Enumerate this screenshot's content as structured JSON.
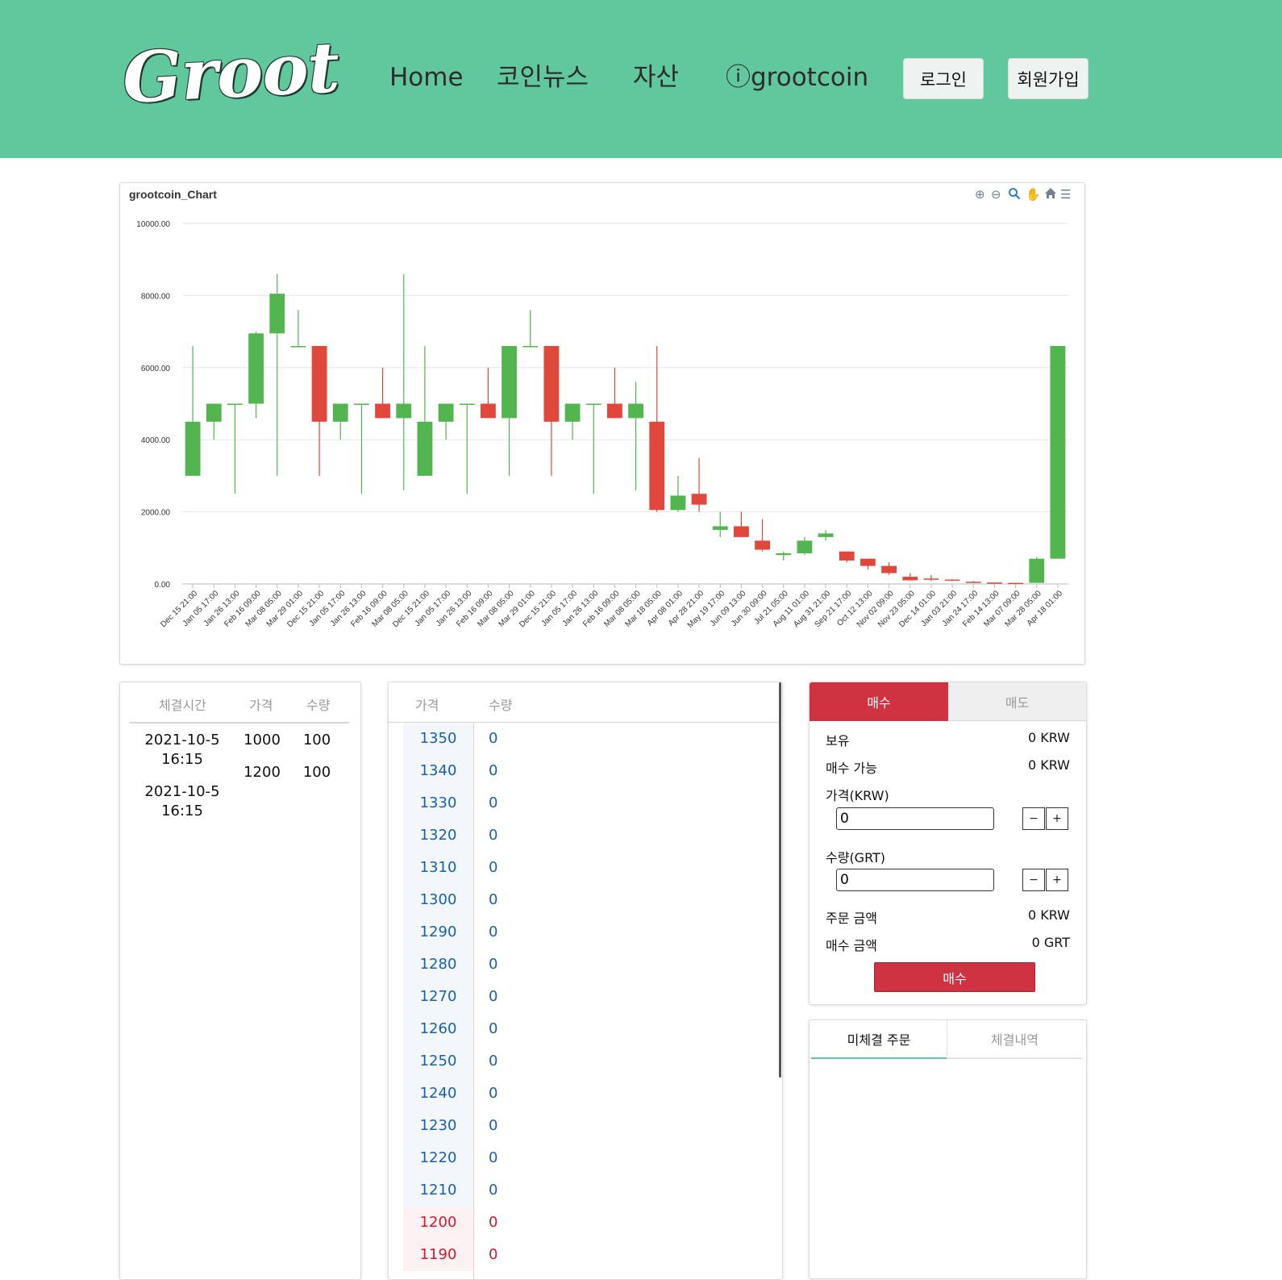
{
  "header": {
    "logo_text": "Groot",
    "nav": [
      "Home",
      "코인뉴스",
      "자산",
      "ⓘgrootcoin"
    ],
    "login_label": "로그인",
    "signup_label": "회원가입"
  },
  "chart": {
    "title": "grootcoin_Chart",
    "toolbar_icons": [
      "zoom-in-icon",
      "zoom-out-icon",
      "zoom-select-icon",
      "pan-hand-icon",
      "home-reset-icon",
      "menu-icon"
    ]
  },
  "chart_data": {
    "type": "candlestick",
    "ylim": [
      0,
      10000
    ],
    "yticks": [
      "0.00",
      "2000.00",
      "4000.00",
      "6000.00",
      "8000.00",
      "10000.00"
    ],
    "grid": true,
    "xtick_labels": [
      "Dec 15 21:00",
      "Jan 05 17:00",
      "Jan 26 13:00",
      "Feb 16 09:00",
      "Mar 08 05:00",
      "Mar 29 01:00",
      "Dec 15 21:00",
      "Jan 05 17:00",
      "Jan 26 13:00",
      "Feb 16 09:00",
      "Mar 08 05:00",
      "Dec 15 21:00",
      "Jan 05 17:00",
      "Jan 26 13:00",
      "Feb 16 09:00",
      "Mar 08 05:00",
      "Mar 29 01:00",
      "Dec 15 21:00",
      "Jan 05 17:00",
      "Jan 26 13:00",
      "Feb 16 09:00",
      "Mar 08 05:00",
      "Mar 18 05:00",
      "Apr 08 01:00",
      "Apr 28 21:00",
      "May 19 17:00",
      "Jun 09 13:00",
      "Jun 30 09:00",
      "Jul 21 05:00",
      "Aug 11 01:00",
      "Aug 31 21:00",
      "Sep 21 17:00",
      "Oct 12 13:00",
      "Nov 02 09:00",
      "Nov 23 05:00",
      "Dec 14 01:00",
      "Jan 03 21:00",
      "Jan 24 17:00",
      "Feb 14 13:00",
      "Mar 07 09:00",
      "Mar 28 05:00",
      "Apr 18 01:00"
    ],
    "candles": [
      {
        "o": 3000,
        "h": 6600,
        "l": 3000,
        "c": 4500
      },
      {
        "o": 4500,
        "h": 5000,
        "l": 4000,
        "c": 5000
      },
      {
        "o": 5000,
        "h": 5000,
        "l": 2500,
        "c": 5000
      },
      {
        "o": 5000,
        "h": 7000,
        "l": 4600,
        "c": 6950
      },
      {
        "o": 6950,
        "h": 8600,
        "l": 3000,
        "c": 8050
      },
      {
        "o": 6600,
        "h": 7600,
        "l": 6600,
        "c": 6600
      },
      {
        "o": 6600,
        "h": 6600,
        "l": 3000,
        "c": 4500
      },
      {
        "o": 4500,
        "h": 5000,
        "l": 4000,
        "c": 5000
      },
      {
        "o": 5000,
        "h": 5000,
        "l": 2500,
        "c": 5000
      },
      {
        "o": 5000,
        "h": 6000,
        "l": 4600,
        "c": 4600
      },
      {
        "o": 4600,
        "h": 8600,
        "l": 2600,
        "c": 5000
      },
      {
        "o": 3000,
        "h": 6600,
        "l": 3000,
        "c": 4500
      },
      {
        "o": 4500,
        "h": 5000,
        "l": 4000,
        "c": 5000
      },
      {
        "o": 5000,
        "h": 5000,
        "l": 2500,
        "c": 5000
      },
      {
        "o": 5000,
        "h": 6000,
        "l": 4600,
        "c": 4600
      },
      {
        "o": 4600,
        "h": 6600,
        "l": 3000,
        "c": 6600
      },
      {
        "o": 6600,
        "h": 7600,
        "l": 6600,
        "c": 6600
      },
      {
        "o": 6600,
        "h": 6600,
        "l": 3000,
        "c": 4500
      },
      {
        "o": 4500,
        "h": 5000,
        "l": 4000,
        "c": 5000
      },
      {
        "o": 5000,
        "h": 5000,
        "l": 2500,
        "c": 5000
      },
      {
        "o": 5000,
        "h": 6000,
        "l": 4600,
        "c": 4600
      },
      {
        "o": 4600,
        "h": 5600,
        "l": 2600,
        "c": 5000
      },
      {
        "o": 4500,
        "h": 6600,
        "l": 2000,
        "c": 2050
      },
      {
        "o": 2050,
        "h": 3000,
        "l": 2000,
        "c": 2450
      },
      {
        "o": 2500,
        "h": 3500,
        "l": 2000,
        "c": 2200
      },
      {
        "o": 1500,
        "h": 2000,
        "l": 1300,
        "c": 1600
      },
      {
        "o": 1600,
        "h": 2000,
        "l": 1300,
        "c": 1300
      },
      {
        "o": 1200,
        "h": 1800,
        "l": 900,
        "c": 950
      },
      {
        "o": 800,
        "h": 900,
        "l": 650,
        "c": 850
      },
      {
        "o": 850,
        "h": 1300,
        "l": 800,
        "c": 1200
      },
      {
        "o": 1300,
        "h": 1500,
        "l": 1200,
        "c": 1400
      },
      {
        "o": 900,
        "h": 900,
        "l": 600,
        "c": 650
      },
      {
        "o": 700,
        "h": 700,
        "l": 400,
        "c": 500
      },
      {
        "o": 500,
        "h": 600,
        "l": 250,
        "c": 300
      },
      {
        "o": 200,
        "h": 300,
        "l": 100,
        "c": 100
      },
      {
        "o": 150,
        "h": 250,
        "l": 80,
        "c": 120
      },
      {
        "o": 120,
        "h": 130,
        "l": 100,
        "c": 110
      },
      {
        "o": 60,
        "h": 80,
        "l": 40,
        "c": 40
      },
      {
        "o": 40,
        "h": 40,
        "l": 20,
        "c": 30
      },
      {
        "o": 30,
        "h": 30,
        "l": 10,
        "c": 20
      },
      {
        "o": 30,
        "h": 750,
        "l": 30,
        "c": 700
      },
      {
        "o": 700,
        "h": 6600,
        "l": 700,
        "c": 6600
      }
    ],
    "up_color": "#53b54f",
    "down_color": "#e0483c"
  },
  "trades": {
    "headers": [
      "체결시간",
      "가격",
      "수량"
    ],
    "rows": [
      {
        "time_date": "2021-10-5",
        "time_clock": "16:15",
        "price": "1000",
        "qty": "100"
      },
      {
        "time_date": "2021-10-5",
        "time_clock": "16:15",
        "price": "1200",
        "qty": "100"
      }
    ]
  },
  "orderbook": {
    "headers": [
      "가격",
      "수량"
    ],
    "asks": [
      {
        "price": "1350",
        "qty": "0"
      },
      {
        "price": "1340",
        "qty": "0"
      },
      {
        "price": "1330",
        "qty": "0"
      },
      {
        "price": "1320",
        "qty": "0"
      },
      {
        "price": "1310",
        "qty": "0"
      },
      {
        "price": "1300",
        "qty": "0"
      },
      {
        "price": "1290",
        "qty": "0"
      },
      {
        "price": "1280",
        "qty": "0"
      },
      {
        "price": "1270",
        "qty": "0"
      },
      {
        "price": "1260",
        "qty": "0"
      },
      {
        "price": "1250",
        "qty": "0"
      },
      {
        "price": "1240",
        "qty": "0"
      },
      {
        "price": "1230",
        "qty": "0"
      },
      {
        "price": "1220",
        "qty": "0"
      },
      {
        "price": "1210",
        "qty": "0"
      }
    ],
    "bids": [
      {
        "price": "1200",
        "qty": "0"
      },
      {
        "price": "1190",
        "qty": "0"
      }
    ]
  },
  "order_form": {
    "tab_buy": "매수",
    "tab_sell": "매도",
    "holding_label": "보유",
    "holding_value": "0 KRW",
    "available_label": "매수 가능",
    "available_value": "0 KRW",
    "price_label": "가격(KRW)",
    "price_value": "0",
    "qty_label": "수량(GRT)",
    "qty_value": "0",
    "minus": "−",
    "plus": "+",
    "order_amount_label": "주문 금액",
    "order_amount_value": "0 KRW",
    "buy_amount_label": "매수 금액",
    "buy_amount_value": "0 GRT",
    "submit_label": "매수"
  },
  "history": {
    "tab_open": "미체결 주문",
    "tab_done": "체결내역"
  }
}
